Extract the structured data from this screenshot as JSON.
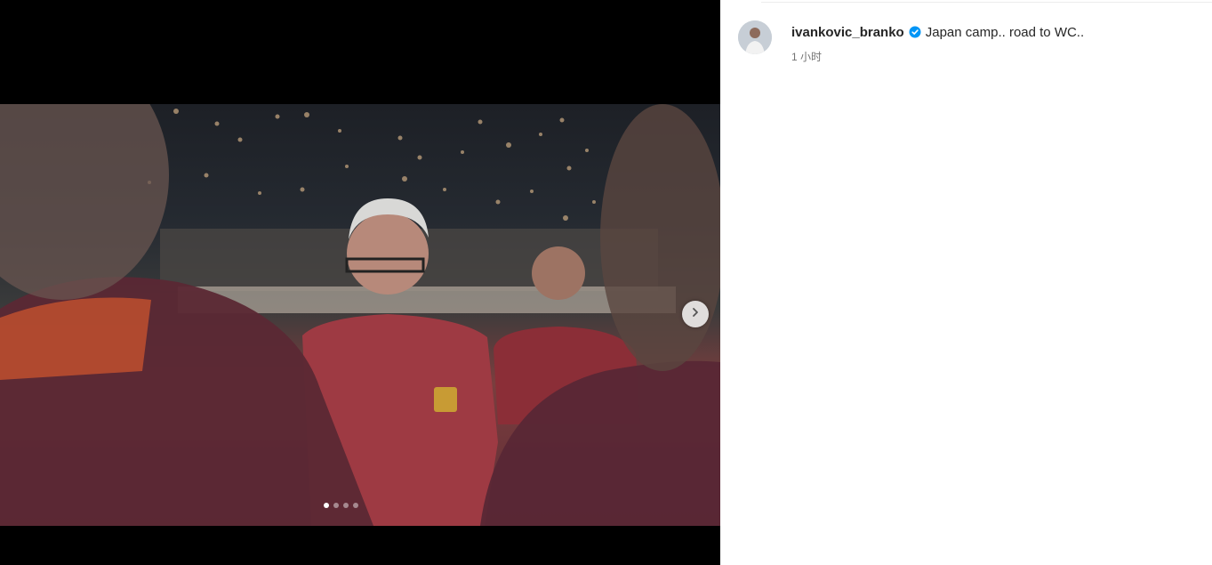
{
  "post": {
    "username": "ivankovic_branko",
    "caption": "Japan camp.. road to WC..",
    "timestamp": "1 小时",
    "verified": true
  },
  "carousel": {
    "slide_count": 4,
    "active_slide": 1
  },
  "icons": {
    "verified_badge": "verified-badge-icon",
    "next": "chevron-right-icon"
  },
  "colors": {
    "verified_blue": "#0095f6",
    "text_primary": "#262626",
    "text_secondary": "#737373"
  }
}
